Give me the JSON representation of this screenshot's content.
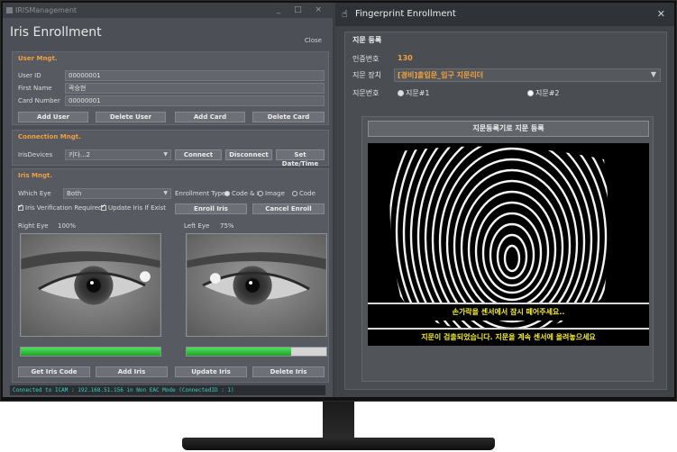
{
  "left_window": {
    "titlebar": "IRISManagement",
    "controls": "_ □ ×",
    "title": "Iris Enrollment",
    "close_label": "Close",
    "user_section": {
      "title": "User Mngt.",
      "user_id_label": "User ID",
      "user_id_value": "00000001",
      "first_name_label": "First Name",
      "first_name_value": "곽승현",
      "card_number_label": "Card Number",
      "card_number_value": "00000001",
      "buttons": [
        "Add User",
        "Delete User",
        "Add Card",
        "Delete Card"
      ]
    },
    "connection_section": {
      "title": "Connection Mngt.",
      "devices_label": "IrisDevices",
      "devices_value": "키다...2",
      "connect": "Connect",
      "disconnect": "Disconnect",
      "set_date": "Set Date/Time"
    },
    "iris_section": {
      "title": "Iris Mngt.",
      "which_eye_label": "Which Eye",
      "which_eye_value": "Both",
      "enrollment_type_label": "Enrollment Type",
      "opt_code": "Code & I",
      "opt_image": "Image",
      "opt_code2": "Code",
      "verification_required": "Iris Verification Required",
      "update_if_exist": "Update Iris If Exist",
      "enroll_iris": "Enroll Iris",
      "cancel_enroll": "Cancel Enroll",
      "right_eye_label": "Right Eye",
      "right_eye_pct": "100%",
      "left_eye_label": "Left Eye",
      "left_eye_pct": "75%",
      "right_progress": 1.0,
      "left_progress": 0.75,
      "bottom_buttons": [
        "Get Iris Code",
        "Add Iris",
        "Update Iris",
        "Delete Iris"
      ]
    },
    "status_text": "Connected to ICAM : 192.168.51.156 in Non EAC Mode (ConnectedID : 1)"
  },
  "right_window": {
    "title": "Fingerprint Enrollment",
    "section_title": "지문 등록",
    "auth_no_label": "인증번호",
    "auth_no_value": "130",
    "device_label": "지문 장치",
    "device_value": "[경비]출입문_입구 지문리더",
    "finger_no_label": "지문번호",
    "finger_opt1": "지문#1",
    "finger_opt2": "지문#2",
    "enroll_button": "지문등록기로 지문 등록",
    "message1": "손가락을 센서에서 잠시 떼어주세요..",
    "message2": "지문이 검출되었습니다. 지문을 계속 센서에 올려놓으세요"
  },
  "colors": {
    "accent": "#f0a040",
    "status_text": "#36d1c6",
    "message_text": "#f2ec36",
    "progress_green": "#2bc23a"
  }
}
